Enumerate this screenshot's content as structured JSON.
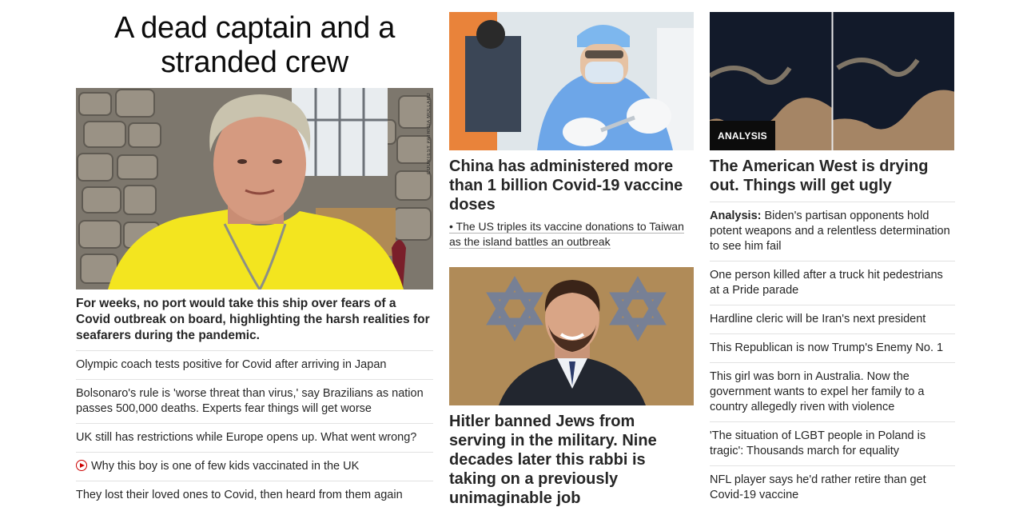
{
  "left": {
    "title": "A dead captain and a stranded crew",
    "photo_credit": "COURTESY PATRICIA MOLLARD",
    "description": "For weeks, no port would take this ship over fears of a Covid outbreak on board, highlighting the harsh realities for seafarers during the pandemic.",
    "links": [
      {
        "text": "Olympic coach tests positive for Covid after arriving in Japan"
      },
      {
        "text": "Bolsonaro's rule is 'worse threat than virus,' say Brazilians as nation passes 500,000 deaths. Experts fear things will get worse"
      },
      {
        "text": "UK still has restrictions while Europe opens up. What went wrong?"
      },
      {
        "text": "Why this boy is one of few kids vaccinated in the UK",
        "icon": "play-video-icon"
      },
      {
        "text": "They lost their loved ones to Covid, then heard from them again"
      }
    ]
  },
  "middle": {
    "story1": {
      "title": "China has administered more than 1 billion Covid-19 vaccine doses",
      "sub": "• The US triples its vaccine donations to Taiwan as the island battles an outbreak"
    },
    "story2": {
      "title": "Hitler banned Jews from serving in the military. Nine decades later this rabbi is taking on a previously unimaginable job"
    }
  },
  "right": {
    "badge": "ANALYSIS",
    "title": "The American West is drying out. Things will get ugly",
    "links": [
      {
        "prefix": "Analysis:",
        "text": "Biden's partisan opponents hold potent weapons and a relentless determination to see him fail"
      },
      {
        "prefix": "",
        "text": "One person killed after a truck hit pedestrians at a Pride parade"
      },
      {
        "prefix": "",
        "text": "Hardline cleric will be Iran's next president"
      },
      {
        "prefix": "",
        "text": "This Republican is now Trump's Enemy No. 1"
      },
      {
        "prefix": "",
        "text": "This girl was born in Australia. Now the government wants to expel her family to a country allegedly riven with violence"
      },
      {
        "prefix": "",
        "text": "'The situation of LGBT people in Poland is tragic': Thousands march for equality"
      },
      {
        "prefix": "",
        "text": "NFL player says he'd rather retire than get Covid-19 vaccine"
      }
    ]
  },
  "colors": {
    "text": "#262626",
    "divider": "#e2e2e2",
    "badge_bg": "#0c0c0c",
    "video_icon": "#cc0000"
  }
}
